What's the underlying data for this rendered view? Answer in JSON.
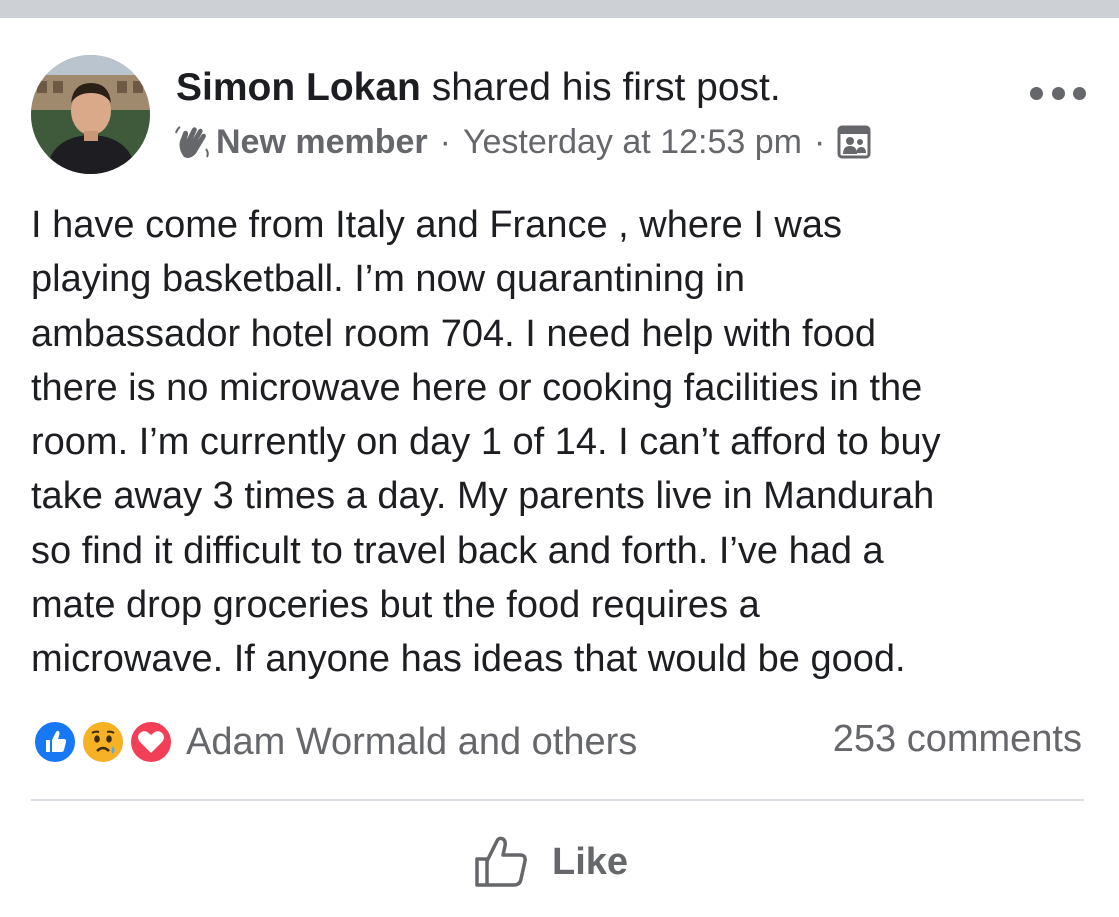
{
  "post": {
    "author": "Simon Lokan",
    "action": "shared his first post.",
    "badge_icon": "wave-icon",
    "badge_label": "New member",
    "separator": "·",
    "timestamp": "Yesterday at 12:53 pm",
    "audience_icon": "group-members-icon",
    "more_icon": "more-options-icon",
    "body_lines": [
      "I have come from Italy and France , where I was",
      "playing basketball. I’m now quarantining in",
      "ambassador hotel room 704. I need help with food",
      "there is no microwave here or cooking facilities in the",
      "room. I’m currently on day 1 of 14. I can’t afford to buy",
      "take away 3 times a day. My parents live in Mandurah",
      "so find it difficult to travel back and forth. I’ve had a",
      "mate drop groceries but the food requires a",
      "microwave. If anyone has ideas that would be good."
    ]
  },
  "engagement": {
    "reaction_icons": [
      "like-reaction-icon",
      "sad-reaction-icon",
      "love-reaction-icon"
    ],
    "reactors": "Adam Wormald and others",
    "comments": "253 comments"
  },
  "actions": {
    "like_label": "Like",
    "like_icon": "thumbs-up-icon"
  },
  "colors": {
    "text_primary": "#1c1e21",
    "text_secondary": "#65676b",
    "like_blue": "#1877f2",
    "sad_yellow": "#f7b125",
    "love_red": "#f33e58",
    "divider": "#dadde1",
    "top_bar": "#cdd0d5"
  }
}
